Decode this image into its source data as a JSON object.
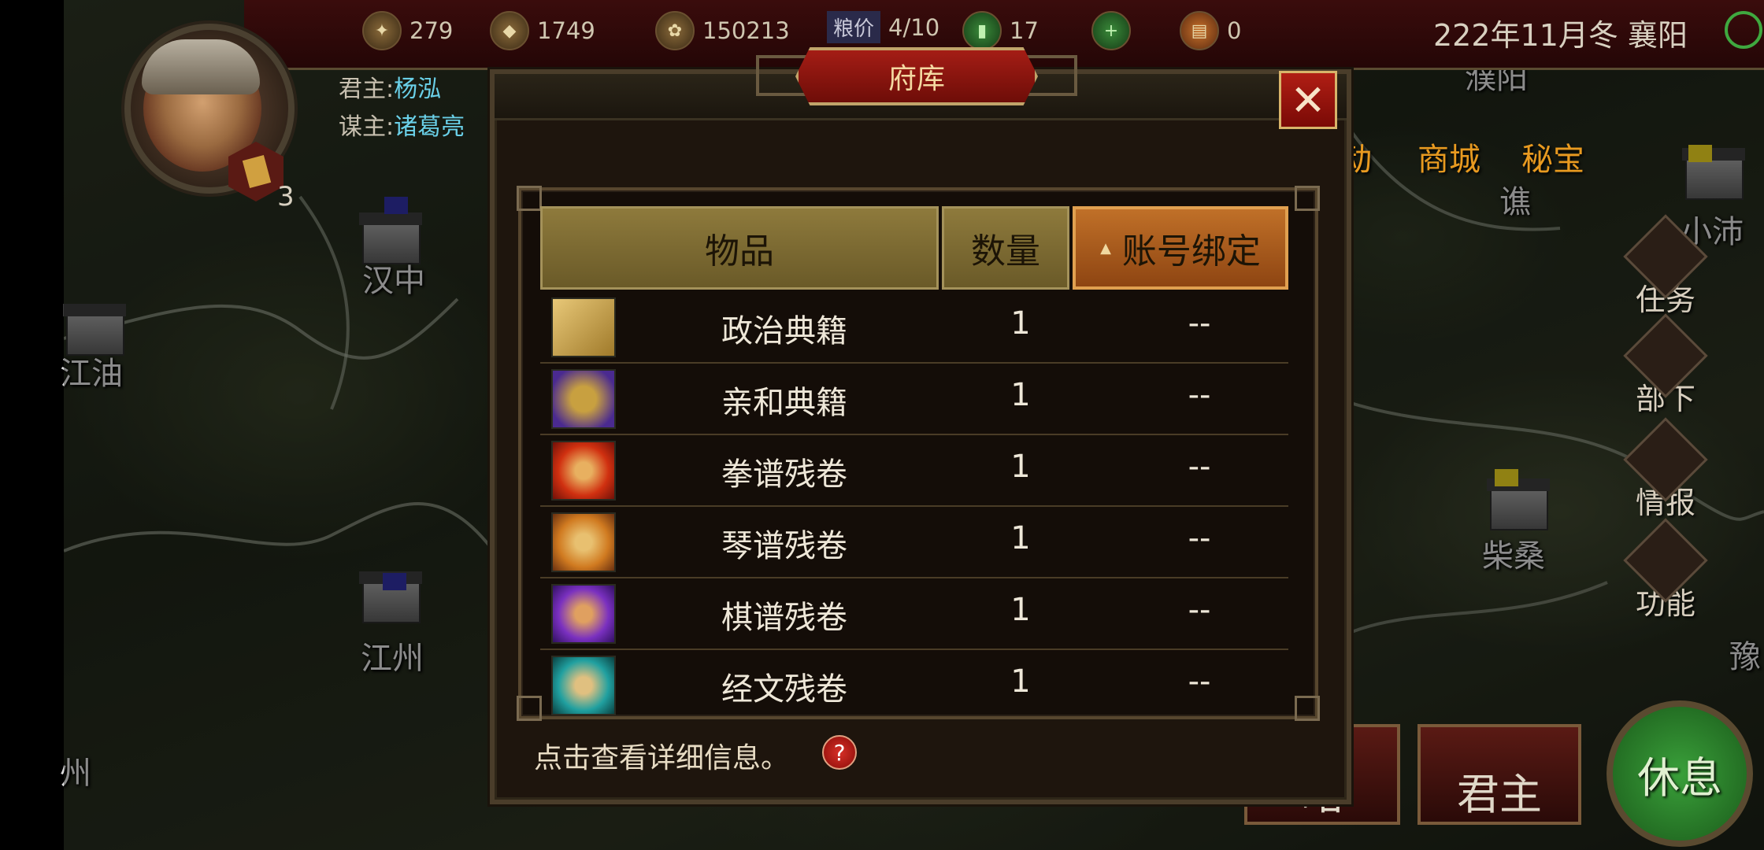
{
  "top_bar": {
    "resources": [
      {
        "icon": "wood-icon",
        "value": "279"
      },
      {
        "icon": "stone-icon",
        "value": "1749"
      },
      {
        "icon": "grain-icon",
        "value": "150213"
      },
      {
        "icon": "grain-price-icon",
        "label": "粮价",
        "value": "4/10"
      },
      {
        "icon": "jade-icon",
        "value": "17"
      },
      {
        "icon": "add-icon",
        "value": ""
      },
      {
        "icon": "book-icon",
        "value": "0"
      }
    ],
    "date_location": "222年11月冬 襄阳"
  },
  "player": {
    "ruler_label": "君主:",
    "ruler_name": "杨泓",
    "advisor_label": "谋主:",
    "advisor_name": "诸葛亮",
    "badge_count": "3"
  },
  "map": {
    "cities": [
      "汉中",
      "江油",
      "江州",
      "州",
      "谯",
      "小沛",
      "柴桑",
      "豫",
      "濮阳"
    ],
    "top_menu": [
      "动",
      "商城",
      "秘宝"
    ],
    "side_buttons": [
      "任务",
      "部下",
      "情报",
      "功能"
    ],
    "bottom_buttons": [
      "君主",
      "略"
    ],
    "rest_button": "休息"
  },
  "dialog": {
    "title": "府库",
    "close_symbol": "✕",
    "columns": {
      "item": "物品",
      "quantity": "数量",
      "bind": "账号绑定",
      "sort_indicator": "▲"
    },
    "items": [
      {
        "icon": "political-classic-icon",
        "name": "政治典籍",
        "quantity": "1",
        "bind": "--"
      },
      {
        "icon": "affinity-classic-icon",
        "name": "亲和典籍",
        "quantity": "1",
        "bind": "--"
      },
      {
        "icon": "fist-manual-fragment-icon",
        "name": "拳谱残卷",
        "quantity": "1",
        "bind": "--"
      },
      {
        "icon": "zither-manual-fragment-icon",
        "name": "琴谱残卷",
        "quantity": "1",
        "bind": "--"
      },
      {
        "icon": "chess-manual-fragment-icon",
        "name": "棋谱残卷",
        "quantity": "1",
        "bind": "--"
      },
      {
        "icon": "scripture-fragment-icon",
        "name": "经文残卷",
        "quantity": "1",
        "bind": "--"
      }
    ],
    "hint": "点击查看详细信息。",
    "help_symbol": "?"
  }
}
